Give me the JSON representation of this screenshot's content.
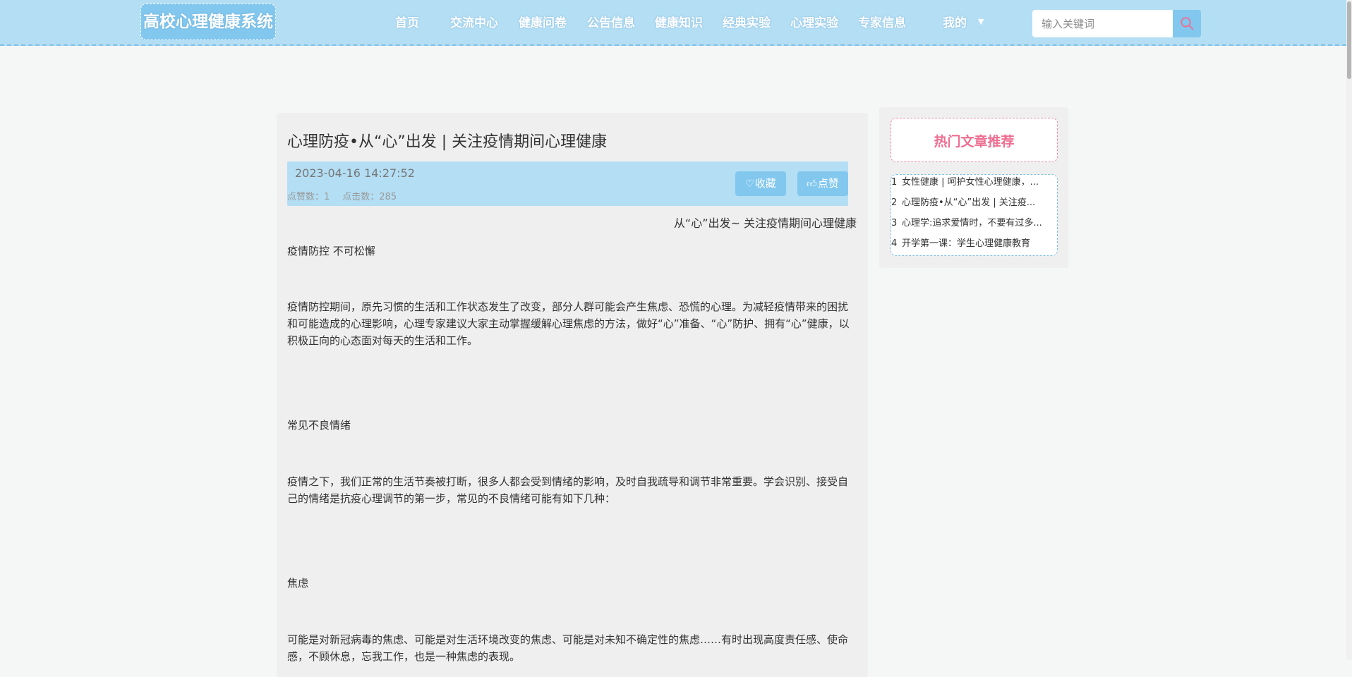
{
  "header": {
    "logo": "高校心理健康系统",
    "nav": [
      "首页",
      "交流中心",
      "健康问卷",
      "公告信息",
      "健康知识",
      "经典实验",
      "心理实验",
      "专家信息",
      "我的"
    ],
    "search_placeholder": "输入关键词",
    "colors": {
      "bar": "#b3def4",
      "accent": "#82c7ee"
    }
  },
  "article": {
    "title": "心理防疫•从“心”出发 | 关注疫情期间心理健康",
    "date": "2023-04-16 14:27:52",
    "likes_label": "点赞数：1",
    "clicks_label": "点击数：285",
    "favorite_label": "收藏",
    "like_label": "点赞",
    "subtitle": "从“心”出发~ 关注疫情期间心理健康",
    "paragraphs": [
      "疫情防控 不可松懈",
      "疫情防控期间，原先习惯的生活和工作状态发生了改变，部分人群可能会产生焦虑、恐慌的心理。为减轻疫情带来的困扰和可能造成的心理影响，心理专家建议大家主动掌握缓解心理焦虑的方法，做好“心”准备、“心”防护、拥有“心”健康，以积极正向的心态面对每天的生活和工作。",
      "常见不良情绪",
      "疫情之下，我们正常的生活节奏被打断，很多人都会受到情绪的影响，及时自我疏导和调节非常重要。学会识别、接受自己的情绪是抗疫心理调节的第一步，常见的不良情绪可能有如下几种：",
      "焦虑",
      "可能是对新冠病毒的焦虑、可能是对生活环境改变的焦虑、可能是对未知不确定性的焦虑……有时出现高度责任感、使命感，不顾休息，忘我工作，也是一种焦虑的表现。"
    ]
  },
  "sidebar": {
    "title": "热门文章推荐",
    "items": [
      {
        "num": "1",
        "text": "女性健康 | 呵护女性心理健康，..."
      },
      {
        "num": "2",
        "text": "心理防疫•从“心”出发 | 关注疫..."
      },
      {
        "num": "3",
        "text": "心理学:追求爱情时，不要有过多..."
      },
      {
        "num": "4",
        "text": "开学第一课：学生心理健康教育"
      }
    ]
  }
}
